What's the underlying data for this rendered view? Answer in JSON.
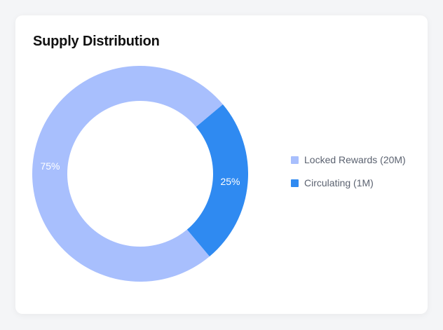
{
  "card": {
    "title": "Supply Distribution"
  },
  "chart_data": {
    "type": "pie",
    "title": "Supply Distribution",
    "donut": true,
    "slices": [
      {
        "label": "Locked Rewards (20M)",
        "value": 75,
        "value_label": "75%",
        "color": "#a8bffd"
      },
      {
        "label": "Circulating (1M)",
        "value": 25,
        "value_label": "25%",
        "color": "#2f8af1"
      }
    ],
    "legend_position": "right"
  }
}
